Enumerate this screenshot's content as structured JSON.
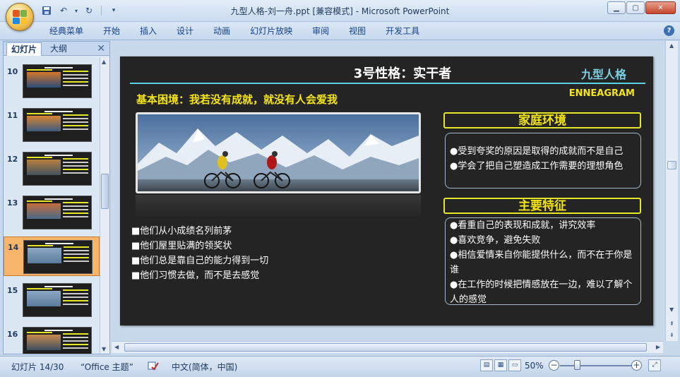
{
  "window": {
    "title": "九型人格-刘一舟.ppt [兼容模式] - Microsoft PowerPoint"
  },
  "ribbon": {
    "tabs": [
      "经典菜单",
      "开始",
      "插入",
      "设计",
      "动画",
      "幻灯片放映",
      "审阅",
      "视图",
      "开发工具"
    ]
  },
  "pane": {
    "tabs": [
      "幻灯片",
      "大纲"
    ],
    "thumbnails": [
      {
        "num": "10"
      },
      {
        "num": "11"
      },
      {
        "num": "12"
      },
      {
        "num": "13"
      },
      {
        "num": "14",
        "selected": true
      },
      {
        "num": "15"
      },
      {
        "num": "16"
      }
    ]
  },
  "slide": {
    "title": "3号性格：实干者",
    "brand": "九型人格",
    "brand_en": "ENNEAGRAM",
    "subtitle": "基本困境：我若没有成就，就没有人会爱我",
    "left_bullets": [
      "■他们从小成绩名列前茅",
      "■他们屋里贴满的领奖状",
      "■他们总是靠自己的能力得到一切",
      "■他们习惯去做，而不是去感觉"
    ],
    "family": {
      "header": "家庭环境",
      "items": [
        "●受到夸奖的原因是取得的成就而不是自己",
        "●学会了把自己塑造成工作需要的理想角色"
      ]
    },
    "traits": {
      "header": "主要特征",
      "items": [
        "●看重自己的表现和成就，讲究效率",
        "●喜欢竞争，避免失败",
        "●相信爱情来自你能提供什么，而不在于你是谁",
        "●在工作的时候把情感放在一边，难以了解个人的感觉"
      ]
    }
  },
  "status": {
    "slide_info": "幻灯片 14/30",
    "theme": "“Office 主题”",
    "language": "中文(简体，中国)",
    "zoom": "50%"
  },
  "colors": {
    "accent_yellow": "#f5e514",
    "accent_cyan": "#5bd3e3",
    "slide_bg": "#242424"
  }
}
